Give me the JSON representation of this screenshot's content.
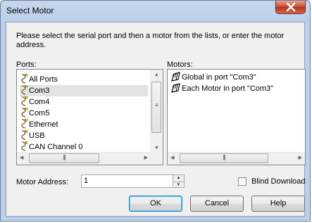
{
  "window": {
    "title": "Select Motor"
  },
  "instructions": "Please select the serial port and then a motor from the lists, or enter the motor address.",
  "ports": {
    "label": "Ports:",
    "items": [
      "All Ports",
      "Com3",
      "Com4",
      "Com5",
      "Ethernet",
      "USB",
      "CAN Channel 0"
    ],
    "selected": "Com3"
  },
  "motors": {
    "label": "Motors:",
    "items": [
      "Global in port \"Com3\"",
      "Each Motor in port \"Com3\""
    ]
  },
  "motor_address": {
    "label": "Motor Address:",
    "value": "1"
  },
  "blind_download": {
    "label": "Blind Download",
    "checked": false
  },
  "buttons": {
    "ok": "OK",
    "cancel": "Cancel",
    "help": "Help"
  },
  "colors": {
    "title_bar": "#bcd0ea",
    "close_button": "#c8482f",
    "dialog_bg": "#f0f0f0",
    "selection": "#e3e3e3"
  }
}
